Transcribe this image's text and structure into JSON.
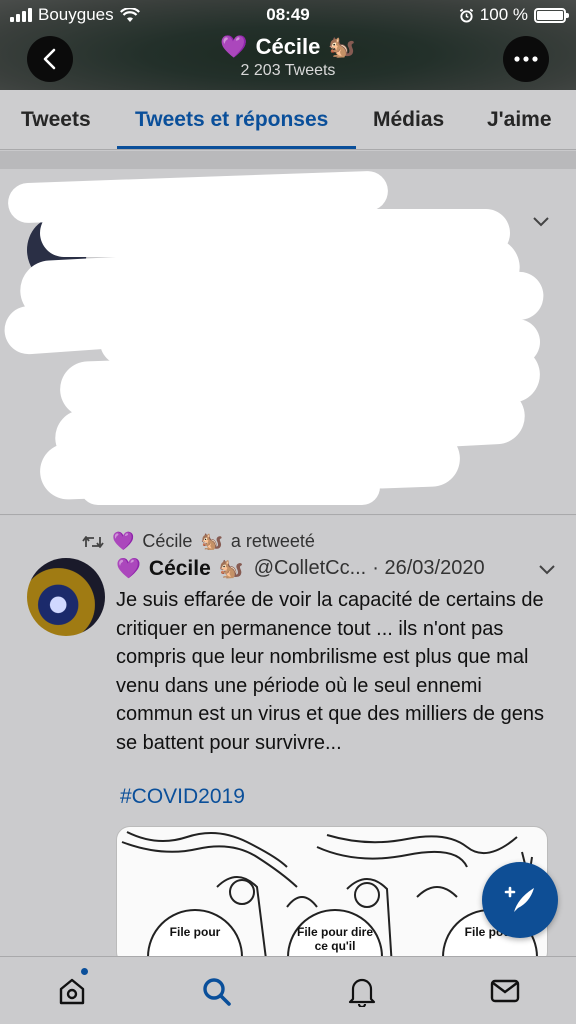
{
  "status_bar": {
    "carrier": "Bouygues",
    "time": "08:49",
    "battery": "100 %",
    "battery_level": 1.0
  },
  "header": {
    "emoji_left": "💜",
    "name": "Cécile",
    "emoji_right": "🐿️",
    "tweet_count": "2 203 Tweets"
  },
  "tabs": [
    {
      "label": "Tweets"
    },
    {
      "label": "Tweets et réponses"
    },
    {
      "label": "Médias"
    },
    {
      "label": "J'aime"
    }
  ],
  "active_tab": "Tweets et réponses",
  "tweet": {
    "retweet_line": "a retweeté",
    "retweeter_emoji_left": "💜",
    "retweeter_name": "Cécile",
    "retweeter_emoji_right": "🐿️",
    "author_emoji_left": "💜",
    "author_name": "Cécile",
    "author_emoji_right": "🐿️",
    "handle": "@ColletCc...",
    "date": "· 26/03/2020",
    "text": "Je suis effarée de voir la capacité de certains de critiquer en permanence tout ... ils n'ont pas compris que leur nombrilisme est plus que mal venu dans une période où le seul ennemi commun est un virus et que des milliers de gens se battent pour survivre...",
    "hashtag": "#COVID2019",
    "media_bubbles": [
      "File pour",
      "File pour dire ce qu'il",
      "File pour"
    ]
  },
  "colors": {
    "accent": "#0a4f9a",
    "fab": "#0e4e95"
  },
  "icons": [
    "back-icon",
    "more-icon",
    "wifi-icon",
    "alarm-icon",
    "retweet-icon",
    "chevron-down-icon",
    "compose-icon",
    "home-icon",
    "search-icon",
    "bell-icon",
    "mail-icon"
  ]
}
